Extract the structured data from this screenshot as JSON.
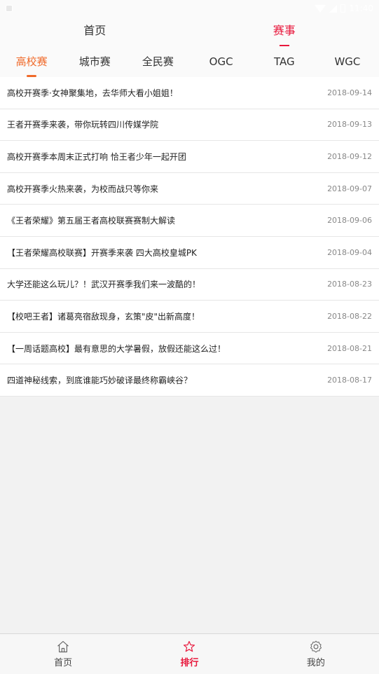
{
  "status": {
    "time": "11:40"
  },
  "top_tabs": [
    {
      "label": "首页"
    },
    {
      "label": "赛事"
    }
  ],
  "sub_tabs": [
    {
      "label": "高校赛"
    },
    {
      "label": "城市赛"
    },
    {
      "label": "全民赛"
    },
    {
      "label": "OGC"
    },
    {
      "label": "TAG"
    },
    {
      "label": "WGC"
    }
  ],
  "news": [
    {
      "title": "高校开赛季·女神聚集地，去华师大看小姐姐！",
      "date": "2018-09-14"
    },
    {
      "title": "王者开赛季来袭，带你玩转四川传媒学院",
      "date": "2018-09-13"
    },
    {
      "title": "高校开赛季本周末正式打响 恰王者少年一起开团",
      "date": "2018-09-12"
    },
    {
      "title": "高校开赛季火热来袭，为校而战只等你来",
      "date": "2018-09-07"
    },
    {
      "title": "《王者荣耀》第五届王者高校联赛赛制大解读",
      "date": "2018-09-06"
    },
    {
      "title": "【王者荣耀高校联赛】开赛季来袭 四大高校皇城PK",
      "date": "2018-09-04"
    },
    {
      "title": "大学还能这么玩儿？！武汉开赛季我们来一波酷的！",
      "date": "2018-08-23"
    },
    {
      "title": "【校吧王者】诸葛亮宿敌现身，玄策\"皮\"出新高度！",
      "date": "2018-08-22"
    },
    {
      "title": "【一周话题高校】最有意思的大学暑假，放假还能这么过！",
      "date": "2018-08-21"
    },
    {
      "title": "四道神秘线索，到底谁能巧妙破译最终称霸峡谷？",
      "date": "2018-08-17"
    }
  ],
  "bottom_tabs": [
    {
      "label": "首页",
      "icon": "home-icon"
    },
    {
      "label": "排行",
      "icon": "star-icon"
    },
    {
      "label": "我的",
      "icon": "gear-icon"
    }
  ],
  "colors": {
    "accent": "#e8183c",
    "sub_accent": "#f06a2a"
  }
}
